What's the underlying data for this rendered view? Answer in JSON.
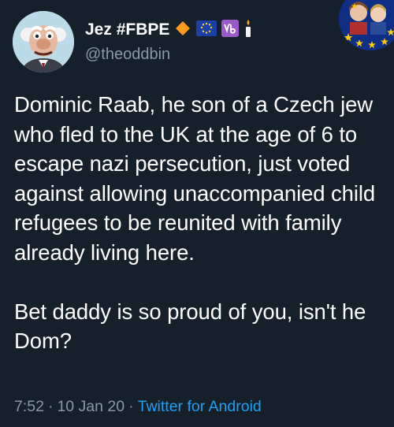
{
  "user": {
    "display_name": "Jez #FBPE",
    "handle": "@theoddbin",
    "avatar_icon": "muppet-statler-avatar",
    "badges": [
      "orange-diamond-icon",
      "eu-flag-icon",
      "capricorn-icon",
      "candle-icon"
    ]
  },
  "tweet": {
    "paragraph_1": "Dominic Raab, he son of a Czech jew who fled to the UK at the age of 6 to escape nazi persecution, just voted against allowing unaccompanied child refugees to be reunited with family already living here.",
    "paragraph_2": "Bet daddy is so proud of you, isn't he Dom?"
  },
  "meta": {
    "time": "7:52",
    "separator": "·",
    "date": "10 Jan 20",
    "client": "Twitter for Android"
  },
  "colors": {
    "background": "#15202b",
    "text": "#ffffff",
    "secondary_text": "#8899a6",
    "link": "#1da1f2"
  }
}
